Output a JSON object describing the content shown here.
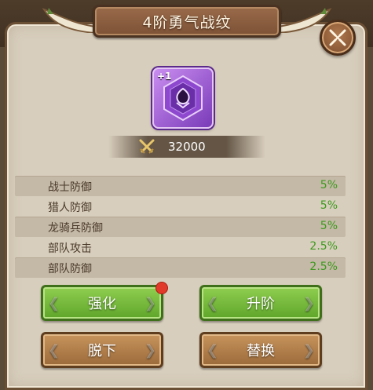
{
  "dialog": {
    "title": "4阶勇气战纹",
    "close_icon": "close-x-icon"
  },
  "rune": {
    "level_badge": "+1",
    "icon": "purple-hexagon-rune-icon",
    "color": "#9b55d6"
  },
  "power": {
    "icon": "crossed-swords-icon",
    "value": "32000"
  },
  "stats": [
    {
      "name": "战士防御",
      "value": "5%"
    },
    {
      "name": "猎人防御",
      "value": "5%"
    },
    {
      "name": "龙骑兵防御",
      "value": "5%"
    },
    {
      "name": "部队攻击",
      "value": "2.5%"
    },
    {
      "name": "部队防御",
      "value": "2.5%"
    }
  ],
  "buttons": {
    "enhance": "强化",
    "upgrade": "升阶",
    "unequip": "脱下",
    "replace": "替换"
  },
  "colors": {
    "stat_value": "#3d9a1e",
    "notification": "#e23a2a"
  }
}
